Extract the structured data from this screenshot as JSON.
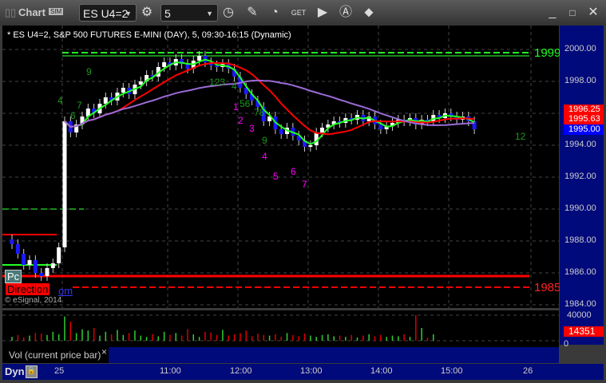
{
  "window": {
    "title": "Chart",
    "sim_badge": "SIM",
    "symbol": "ES U4=2",
    "interval": "5",
    "buttons": [
      "settings-icon",
      "clock-icon",
      "pencil-icon",
      "studies-icon",
      "get-icon",
      "play-icon",
      "alert-icon",
      "link-icon"
    ],
    "min": "_",
    "max": "□",
    "close": "✕"
  },
  "chart": {
    "header": "* ES U4=2, S&P 500 FUTURES E-MINI (DAY), 5, 09:30-16:15 (Dynamic)",
    "copyright": "© eSignal, 2014",
    "direction_label": "Direction",
    "direction_suffix": "om",
    "pc_label": "Pc",
    "level_high_label": "1999",
    "level_low_label": "1985",
    "price_axis": [
      "2000.00",
      "1998.00",
      "1996.00",
      "1994.00",
      "1992.00",
      "1990.00",
      "1988.00",
      "1986.00",
      "1984.00"
    ],
    "price_tags": [
      {
        "value": "1996.25",
        "color": "#ff0000"
      },
      {
        "value": "1995.63",
        "color": "#ff0000"
      },
      {
        "value": "1995.00",
        "color": "#0000ff"
      }
    ],
    "green_counts": [
      "9",
      "4",
      "7",
      "6",
      "123",
      "4",
      "56",
      "78",
      "9",
      "12"
    ],
    "magenta_counts": [
      "1",
      "2",
      "3",
      "4",
      "5",
      "6",
      "7"
    ]
  },
  "volume": {
    "label": "Vol (current price bar)",
    "close": "×",
    "axis": [
      "40000",
      "0"
    ],
    "current": "14351"
  },
  "time_axis": {
    "mode": "Dyn",
    "labels": [
      "25",
      "11:00",
      "12:00",
      "13:00",
      "14:00",
      "15:00",
      "26"
    ]
  },
  "chart_data": {
    "type": "candlestick",
    "ylim": [
      1984,
      2001
    ],
    "prev_closes": [
      1987.8,
      1987.2,
      1986.5,
      1986.8,
      1986.0,
      1985.8,
      1986.3,
      1986.6,
      1987.6
    ],
    "closes": [
      1995.5,
      1994.8,
      1995.3,
      1995.8,
      1996.3,
      1996.0,
      1996.6,
      1997.0,
      1996.8,
      1997.3,
      1997.6,
      1997.2,
      1997.8,
      1998.0,
      1998.4,
      1998.3,
      1998.9,
      1999.2,
      1999.0,
      1999.4,
      1999.1,
      1998.8,
      1999.3,
      1999.6,
      1999.2,
      1999.0,
      1998.9,
      1999.1,
      1998.8,
      1998.3,
      1997.6,
      1997.2,
      1996.8,
      1996.4,
      1995.5,
      1995.8,
      1995.0,
      1994.7,
      1995.1,
      1994.6,
      1994.3,
      1993.9,
      1994.0,
      1994.8,
      1995.1,
      1995.3,
      1995.5,
      1995.4,
      1995.7,
      1995.6,
      1995.9,
      1995.5,
      1995.8,
      1995.3,
      1995.0,
      1995.2,
      1995.4,
      1995.6,
      1995.5,
      1995.7,
      1995.3,
      1995.6,
      1995.5,
      1995.9,
      1995.7,
      1996.0,
      1995.8,
      1995.6,
      1995.8,
      1995.5,
      1995.0
    ],
    "volumes": [
      6,
      9,
      5,
      8,
      12,
      11,
      9,
      14,
      10,
      38,
      30,
      12,
      18,
      16,
      20,
      8,
      14,
      10,
      17,
      9,
      12,
      16,
      8,
      6,
      10,
      7,
      14,
      9,
      12,
      8,
      18,
      10,
      6,
      14,
      13,
      9,
      17,
      8,
      10,
      12,
      16,
      7,
      11,
      9,
      8,
      10,
      6,
      12,
      9,
      7,
      11,
      8,
      6,
      9,
      10,
      7,
      8,
      6,
      9,
      5,
      8,
      10,
      7,
      9,
      6,
      8,
      7,
      10,
      6,
      40,
      20,
      5,
      10
    ],
    "levels": {
      "high_dashed": 1999.8,
      "high_solid": 1999.6,
      "low_solid": 1985.8,
      "low_dashed": 1985.1,
      "prev_dashed": 1990.0
    }
  }
}
